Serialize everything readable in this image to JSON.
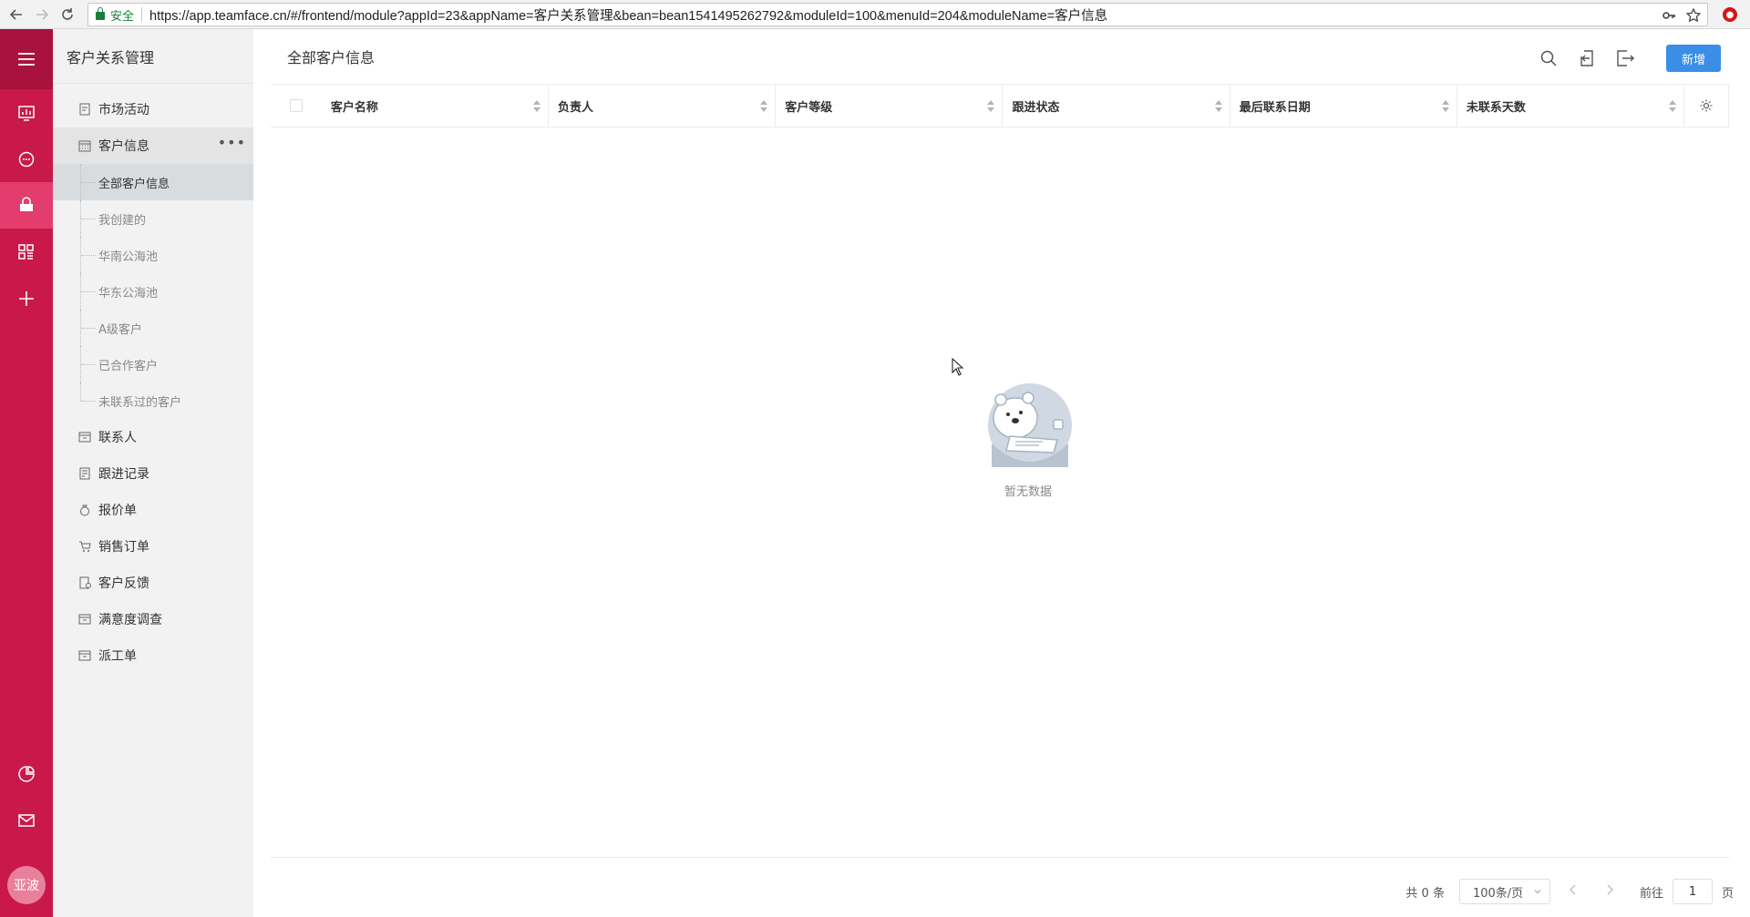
{
  "browser": {
    "secure_label": "安全",
    "url": "https://app.teamface.cn/#/frontend/module?appId=23&appName=客户关系管理&bean=bean1541495262792&moduleId=100&menuId=204&moduleName=客户信息"
  },
  "iconbar": {
    "avatar_label": "亚波",
    "accent_color": "#c9184a"
  },
  "sidebar": {
    "title": "客户关系管理",
    "items": [
      {
        "label": "市场活动"
      },
      {
        "label": "客户信息"
      },
      {
        "label": "联系人"
      },
      {
        "label": "跟进记录"
      },
      {
        "label": "报价单"
      },
      {
        "label": "销售订单"
      },
      {
        "label": "客户反馈"
      },
      {
        "label": "满意度调查"
      },
      {
        "label": "派工单"
      }
    ],
    "sub_items": [
      {
        "label": "全部客户信息"
      },
      {
        "label": "我创建的"
      },
      {
        "label": "华南公海池"
      },
      {
        "label": "华东公海池"
      },
      {
        "label": "A级客户"
      },
      {
        "label": "已合作客户"
      },
      {
        "label": "未联系过的客户"
      }
    ]
  },
  "main": {
    "title": "全部客户信息",
    "new_button": "新增",
    "columns": [
      "客户名称",
      "负责人",
      "客户等级",
      "跟进状态",
      "最后联系日期",
      "未联系天数"
    ],
    "empty_text": "暂无数据"
  },
  "pager": {
    "total": "共 0 条",
    "page_size": "100条/页",
    "goto_label": "前往",
    "page_value": "1",
    "page_suffix": "页"
  }
}
